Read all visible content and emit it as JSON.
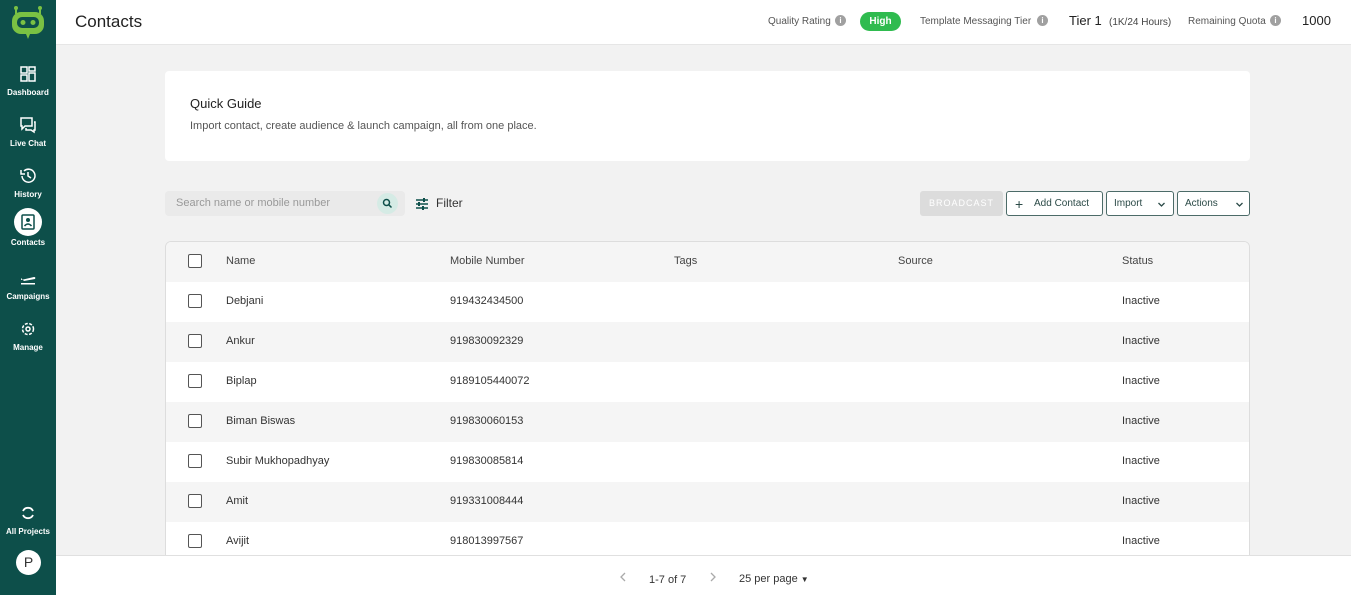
{
  "sidebar": {
    "items": [
      {
        "label": "Dashboard",
        "icon": "dashboard-icon"
      },
      {
        "label": "Live Chat",
        "icon": "chat-icon"
      },
      {
        "label": "History",
        "icon": "history-icon"
      },
      {
        "label": "Contacts",
        "icon": "contacts-icon"
      },
      {
        "label": "Campaigns",
        "icon": "plane-icon"
      },
      {
        "label": "Manage",
        "icon": "gear-icon"
      }
    ],
    "all_projects": "All Projects",
    "avatar_letter": "P"
  },
  "header": {
    "title": "Contacts",
    "quality_rating_label": "Quality Rating",
    "quality_rating_value": "High",
    "tier_label": "Template Messaging Tier",
    "tier_value": "Tier 1",
    "tier_detail": "(1K/24 Hours)",
    "quota_label": "Remaining Quota",
    "quota_value": "1000"
  },
  "guide": {
    "title": "Quick Guide",
    "description": "Import contact, create audience & launch campaign, all from one place."
  },
  "toolbar": {
    "search_placeholder": "Search name or mobile number",
    "filter_label": "Filter",
    "broadcast_label": "BROADCAST",
    "add_contact_label": "Add Contact",
    "import_label": "Import",
    "actions_label": "Actions"
  },
  "table": {
    "columns": [
      "Name",
      "Mobile Number",
      "Tags",
      "Source",
      "Status"
    ],
    "rows": [
      {
        "name": "Debjani",
        "mobile": "919432434500",
        "tags": "",
        "source": "",
        "status": "Inactive"
      },
      {
        "name": "Ankur",
        "mobile": "919830092329",
        "tags": "",
        "source": "",
        "status": "Inactive"
      },
      {
        "name": "Biplap",
        "mobile": "9189105440072",
        "tags": "",
        "source": "",
        "status": "Inactive"
      },
      {
        "name": "Biman Biswas",
        "mobile": "919830060153",
        "tags": "",
        "source": "",
        "status": "Inactive"
      },
      {
        "name": "Subir Mukhopadhyay",
        "mobile": "919830085814",
        "tags": "",
        "source": "",
        "status": "Inactive"
      },
      {
        "name": "Amit",
        "mobile": "919331008444",
        "tags": "",
        "source": "",
        "status": "Inactive"
      },
      {
        "name": "Avijit",
        "mobile": "918013997567",
        "tags": "",
        "source": "",
        "status": "Inactive"
      }
    ]
  },
  "pagination": {
    "range": "1-7 of 7",
    "per_page": "25 per page"
  },
  "colors": {
    "sidebar": "#0d4f4a",
    "brand_green": "#7ac143",
    "badge_green": "#2fbb4f"
  }
}
